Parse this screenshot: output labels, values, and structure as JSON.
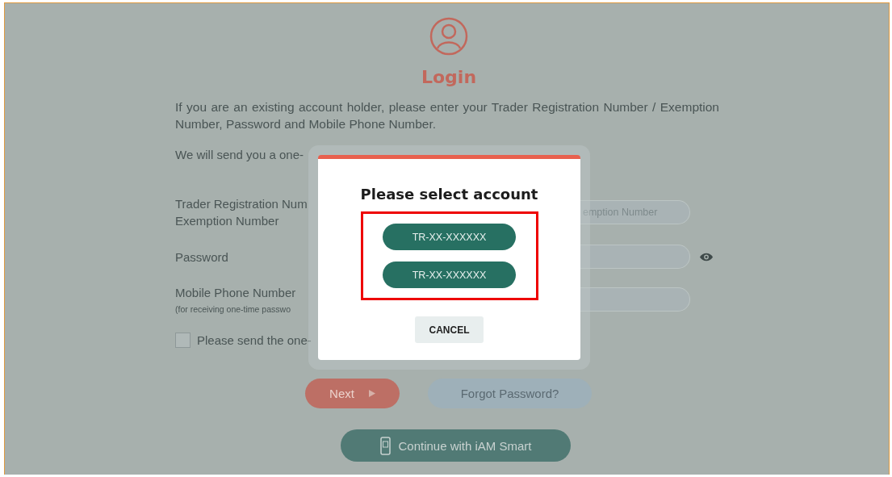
{
  "page": {
    "title": "Login",
    "intro": "If you are an existing account holder, please enter your Trader Registration Number / Exemption Number, Password and Mobile Phone Number.",
    "otp_note": "We will send you a one-",
    "fields": [
      {
        "kind": "text",
        "label": "Trader Registration Num",
        "label_line2": "Exemption Number",
        "placeholder": "emption Number"
      },
      {
        "kind": "password",
        "label": "Password"
      },
      {
        "kind": "text",
        "label": "Mobile Phone Number",
        "hint": "(for receiving one-time passwo"
      }
    ],
    "checkbox": {
      "label": "Please send the one-",
      "checked": false
    },
    "next_button": "Next",
    "forgot_button": "Forgot Password?",
    "iam_button": "Continue with iAM Smart"
  },
  "dialog": {
    "title": "Please select account",
    "accounts": [
      "TR-XX-XXXXXX",
      "TR-XX-XXXXXX"
    ],
    "cancel": "CANCEL"
  }
}
